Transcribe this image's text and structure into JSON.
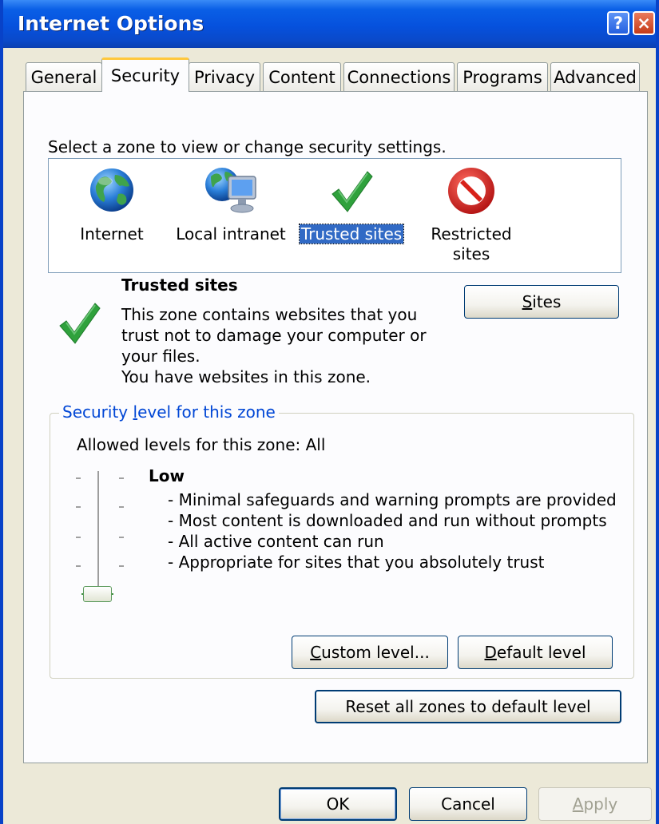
{
  "window": {
    "title": "Internet Options",
    "help": "?",
    "close": "×"
  },
  "tabs": [
    "General",
    "Security",
    "Privacy",
    "Content",
    "Connections",
    "Programs",
    "Advanced"
  ],
  "active_tab": "Security",
  "zone_prompt": "Select a zone to view or change security settings.",
  "zones": [
    {
      "name": "Internet",
      "icon": "globe-icon"
    },
    {
      "name": "Local intranet",
      "icon": "intranet-icon"
    },
    {
      "name": "Trusted sites",
      "icon": "checkmark-icon",
      "selected": true
    },
    {
      "name_line1": "Restricted",
      "name_line2": "sites",
      "icon": "restricted-icon"
    }
  ],
  "zone_info": {
    "title": "Trusted sites",
    "desc_line1": "This zone contains websites that you",
    "desc_line2": "trust not to damage your computer or",
    "desc_line3": "your files.",
    "desc_line4": "You have websites in this zone."
  },
  "sites_button": {
    "accel": "S",
    "rest": "ites"
  },
  "security_level": {
    "group_label": {
      "pre": "Security ",
      "accel": "l",
      "post": "evel for this zone"
    },
    "allowed": "Allowed levels for this zone: All",
    "level": "Low",
    "level_fraction": 0,
    "bullets": [
      "- Minimal safeguards and warning prompts are provided",
      "- Most content is downloaded and run without prompts",
      "- All active content can run",
      "- Appropriate for sites that you absolutely trust"
    ],
    "custom_button": {
      "accel": "C",
      "rest": "ustom level..."
    },
    "default_button": {
      "accel": "D",
      "rest": "efault level"
    }
  },
  "reset_button": "Reset all zones to default level",
  "footer": {
    "ok": "OK",
    "cancel": "Cancel",
    "apply": {
      "accel": "A",
      "rest": "pply"
    }
  },
  "colors": {
    "title_bar": "#0651DD",
    "selection": "#316AC5",
    "check_green": "#2FA13C",
    "restricted_red": "#D8221A",
    "group_label": "#0046D5"
  }
}
